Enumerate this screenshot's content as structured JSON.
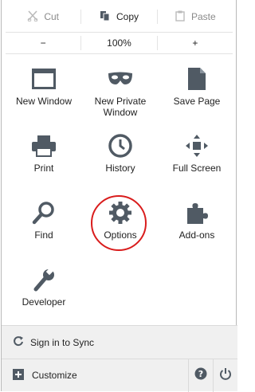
{
  "edit": {
    "cut": "Cut",
    "copy": "Copy",
    "paste": "Paste"
  },
  "zoom": {
    "minus": "−",
    "level": "100%",
    "plus": "+"
  },
  "tiles": [
    {
      "label": "New Window",
      "icon": "window-icon"
    },
    {
      "label": "New Private\nWindow",
      "icon": "mask-icon"
    },
    {
      "label": "Save Page",
      "icon": "document-icon"
    },
    {
      "label": "Print",
      "icon": "printer-icon"
    },
    {
      "label": "History",
      "icon": "clock-icon"
    },
    {
      "label": "Full Screen",
      "icon": "fullscreen-icon"
    },
    {
      "label": "Find",
      "icon": "magnifier-icon"
    },
    {
      "label": "Options",
      "icon": "gear-icon"
    },
    {
      "label": "Add-ons",
      "icon": "puzzle-icon"
    },
    {
      "label": "Developer",
      "icon": "wrench-icon"
    }
  ],
  "footer": {
    "sync": "Sign in to Sync",
    "customize": "Customize"
  },
  "colors": {
    "icon": "#505a64",
    "highlight": "#d91c1c"
  }
}
